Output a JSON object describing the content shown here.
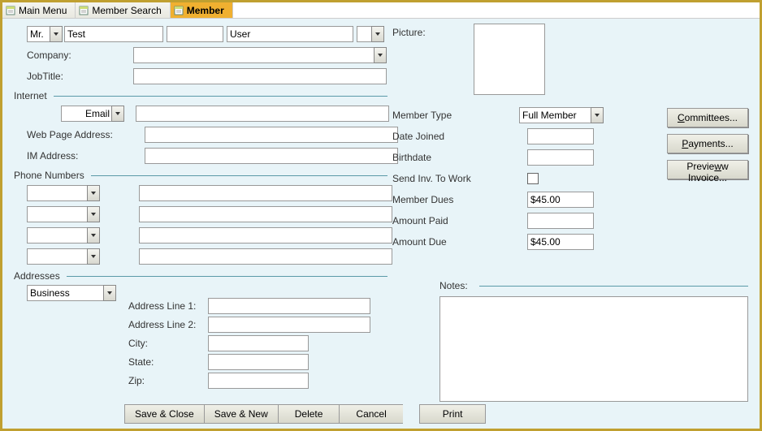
{
  "tabs": [
    {
      "label": "Main Menu",
      "active": false
    },
    {
      "label": "Member Search",
      "active": false
    },
    {
      "label": "Member",
      "active": true
    }
  ],
  "name": {
    "title_value": "Mr.",
    "first_value": "Test",
    "middle_value": "",
    "last_value": "User",
    "suffix_value": ""
  },
  "fields": {
    "company_label": "Company:",
    "company_value": "",
    "jobtitle_label": "JobTitle:",
    "jobtitle_value": "",
    "picture_label": "Picture:"
  },
  "internet": {
    "section": "Internet",
    "type_value": "Email",
    "type_input": "",
    "webpage_label": "Web Page Address:",
    "webpage_value": "",
    "im_label": "IM Address:",
    "im_value": ""
  },
  "phone": {
    "section": "Phone Numbers",
    "rows": [
      {
        "type": "",
        "number": ""
      },
      {
        "type": "",
        "number": ""
      },
      {
        "type": "",
        "number": ""
      },
      {
        "type": "",
        "number": ""
      }
    ]
  },
  "addresses": {
    "section": "Addresses",
    "type_value": "Business",
    "line1_label": "Address Line 1:",
    "line1_value": "",
    "line2_label": "Address Line 2:",
    "line2_value": "",
    "city_label": "City:",
    "city_value": "",
    "state_label": "State:",
    "state_value": "",
    "zip_label": "Zip:",
    "zip_value": ""
  },
  "member": {
    "type_label": "Member Type",
    "type_value": "Full Member",
    "joined_label": "Date Joined",
    "joined_value": "",
    "birth_label": "Birthdate",
    "birth_value": "",
    "sendinv_label": "Send Inv. To Work",
    "sendinv_checked": false,
    "dues_label": "Member Dues",
    "dues_value": "$45.00",
    "paid_label": "Amount Paid",
    "paid_value": "",
    "due_label": "Amount Due",
    "due_value": "$45.00"
  },
  "notes": {
    "label": "Notes:",
    "value": ""
  },
  "side_buttons": {
    "committees": "ommittees...",
    "committees_u": "C",
    "payments": "ayments...",
    "payments_u": "P",
    "preview": "w Invoice...",
    "preview_pre": "Previe",
    "preview_u": "w"
  },
  "bottom_buttons": {
    "save_close": "Save & Close",
    "save_new": "Save & New",
    "delete": "Delete",
    "cancel": "Cancel",
    "print": "Print"
  }
}
